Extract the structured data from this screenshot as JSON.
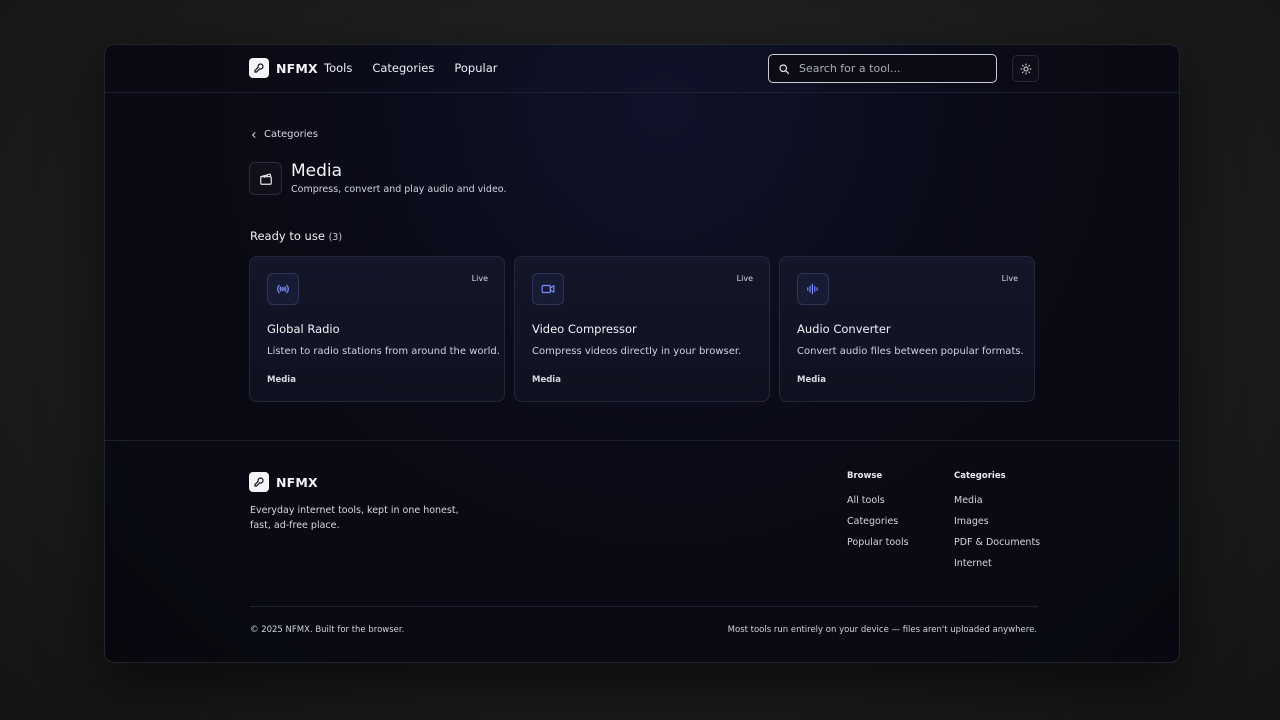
{
  "brand": {
    "name": "NFMX"
  },
  "nav": {
    "items": [
      "Tools",
      "Categories",
      "Popular"
    ]
  },
  "search": {
    "placeholder": "Search for a tool..."
  },
  "breadcrumb": {
    "back_label": "Categories"
  },
  "category": {
    "title": "Media",
    "description": "Compress, convert and play audio and video."
  },
  "section": {
    "title": "Ready to use",
    "count": "(3)"
  },
  "tools": [
    {
      "title": "Global Radio",
      "description": "Listen to radio stations from around the world.",
      "badge": "Live",
      "category": "Media",
      "icon": "radio-icon"
    },
    {
      "title": "Video Compressor",
      "description": "Compress videos directly in your browser.",
      "badge": "Live",
      "category": "Media",
      "icon": "video-camera-icon"
    },
    {
      "title": "Audio Converter",
      "description": "Convert audio files between popular formats.",
      "badge": "Live",
      "category": "Media",
      "icon": "audio-waveform-icon"
    }
  ],
  "footer": {
    "brand": "NFMX",
    "description": "Everyday internet tools, kept in one honest, fast, ad-free place.",
    "browse": {
      "heading": "Browse",
      "links": [
        "All tools",
        "Categories",
        "Popular tools"
      ]
    },
    "categories": {
      "heading": "Categories",
      "links": [
        "Media",
        "Images",
        "PDF & Documents",
        "Internet"
      ]
    },
    "copyright": "© 2025 NFMX. Built for the browser.",
    "note": "Most tools run entirely on your device — files aren't uploaded anywhere."
  },
  "colors": {
    "accent": "#7b8cff",
    "card_bg": "#141629",
    "background": "#0a0b16"
  }
}
